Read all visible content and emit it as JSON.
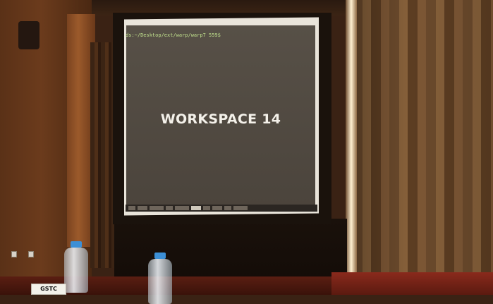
{
  "scene": {
    "description_free": true
  },
  "screen": {
    "terminal_prompt": "ds:~/Desktop/ext/warp/warp7 559$",
    "workspace_title": "WORKSPACE 14"
  },
  "table": {
    "namecard_text": "GSTC"
  },
  "colors": {
    "bottle_cap": "#3c8fd6",
    "screen_bg": "#4f4840",
    "terminal_text": "#bfe08c"
  }
}
